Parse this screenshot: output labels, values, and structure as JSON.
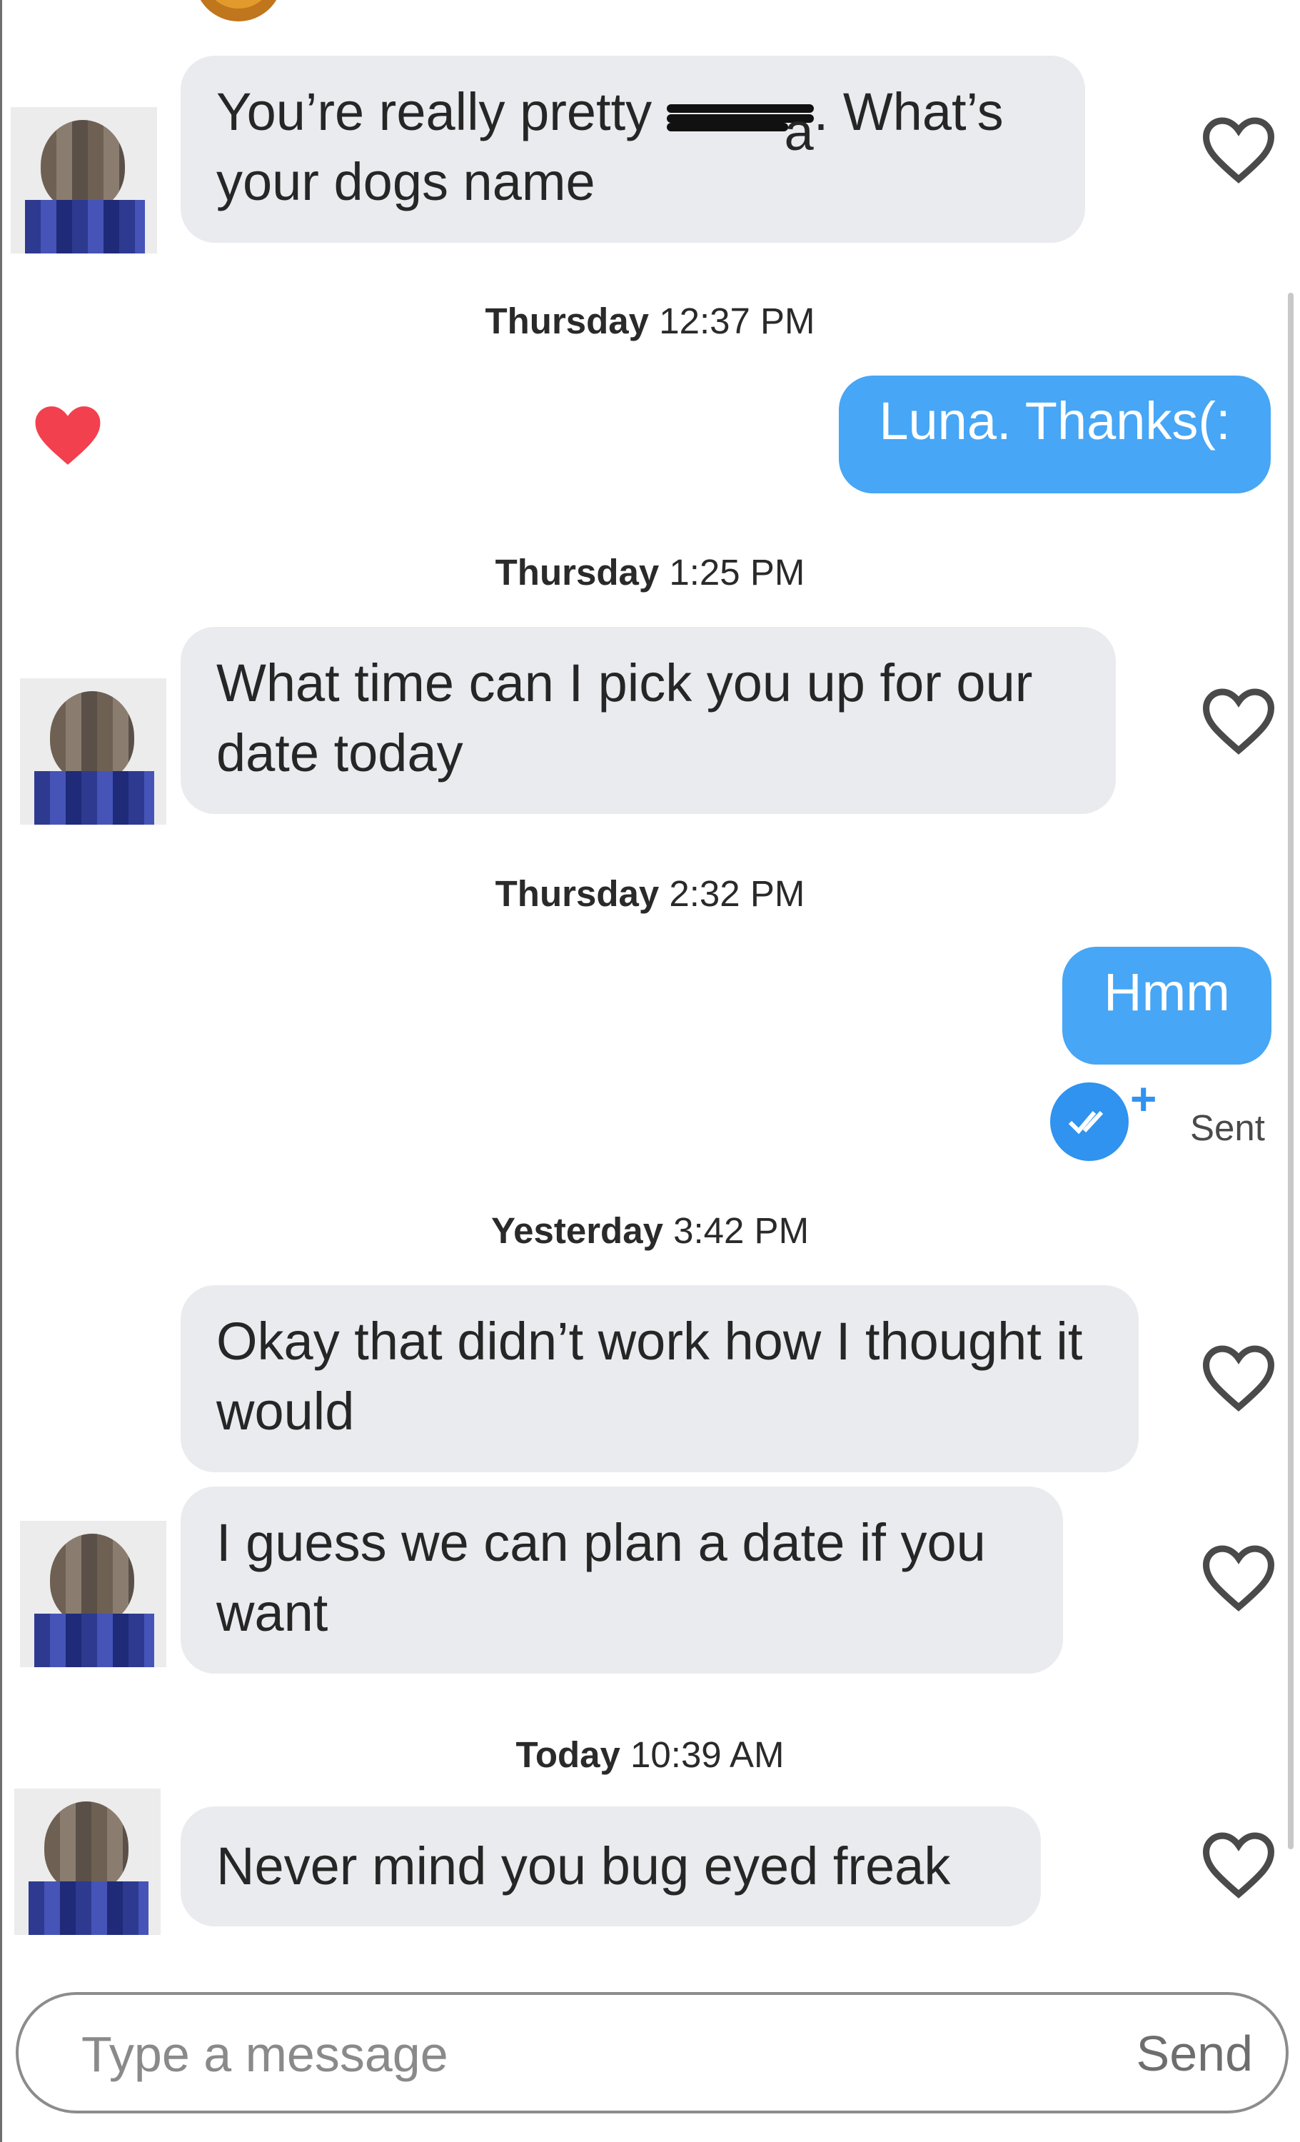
{
  "messages": [
    {
      "type": "incoming",
      "text_before": "You’re really pretty ",
      "redacted_tail": "a",
      "text_after": ". What’s your dogs name"
    },
    {
      "type": "timestamp",
      "day": "Thursday",
      "time": "12:37 PM"
    },
    {
      "type": "outgoing",
      "text": "Luna. Thanks(:",
      "liked": true
    },
    {
      "type": "timestamp",
      "day": "Thursday",
      "time": "1:25 PM"
    },
    {
      "type": "incoming",
      "text": "What time can I pick you up for our date today"
    },
    {
      "type": "timestamp",
      "day": "Thursday",
      "time": "2:32 PM"
    },
    {
      "type": "outgoing",
      "text": "Hmm",
      "status": "Sent"
    },
    {
      "type": "timestamp",
      "day": "Yesterday",
      "time": "3:42 PM"
    },
    {
      "type": "incoming",
      "text": "Okay that didn’t work how I thought it would"
    },
    {
      "type": "incoming",
      "text": "I guess we can plan a date if you want"
    },
    {
      "type": "timestamp",
      "day": "Today",
      "time": "10:39 AM"
    },
    {
      "type": "incoming",
      "text": "Never mind you bug eyed freak"
    }
  ],
  "composer": {
    "placeholder": "Type a message",
    "send_label": "Send"
  },
  "icons": {
    "like": "heart-outline-icon",
    "liked": "heart-filled-icon",
    "read_receipt": "double-check-icon",
    "boost": "plus-icon"
  },
  "colors": {
    "outgoing_bubble": "#47a6f5",
    "incoming_bubble": "#eaebef",
    "liked_heart": "#f2404e",
    "read_badge": "#2f93ef"
  }
}
